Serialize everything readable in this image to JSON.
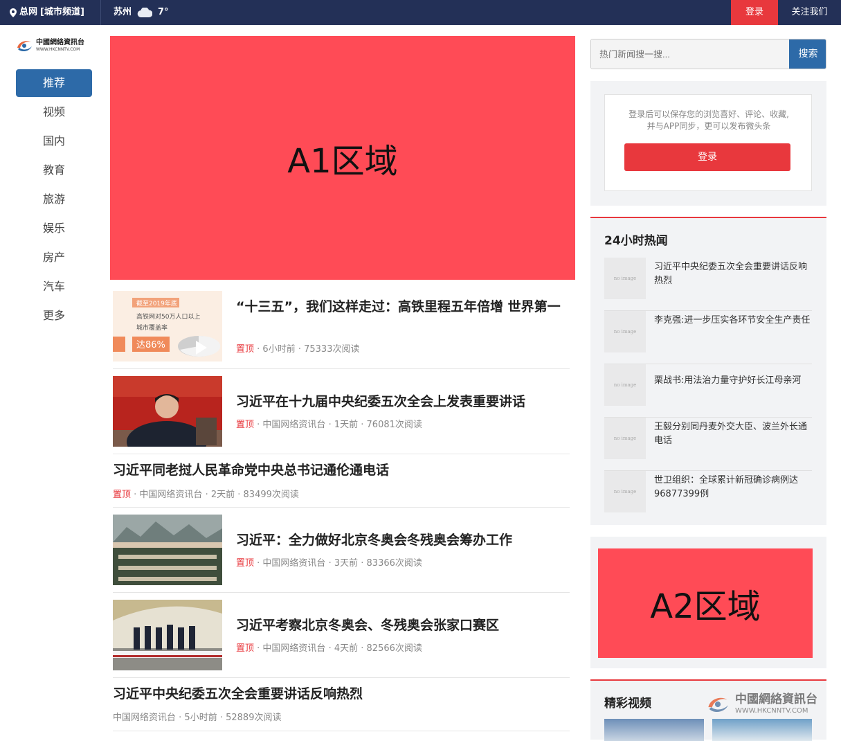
{
  "topbar": {
    "location": "总网",
    "channel": "[城市频道]",
    "city": "苏州",
    "temperature": "7°",
    "login": "登录",
    "follow": "关注我们"
  },
  "logo": {
    "name": "中國網絡資訊台",
    "url": "WWW.HKCNNTV.COM"
  },
  "nav": {
    "items": [
      "推荐",
      "视频",
      "国内",
      "教育",
      "旅游",
      "娱乐",
      "房产",
      "汽车",
      "更多"
    ]
  },
  "banner_a1": "A1区域",
  "banner_a2": "A2区域",
  "news": [
    {
      "title": "“十三五”，我们这样走过：高铁里程五年倍增 世界第一",
      "top": "置顶",
      "source": "",
      "time": "6小时前",
      "reads": "75333次阅读",
      "thumb_text": {
        "l1": "截至2019年底",
        "l2": "高铁网对50万人口以上",
        "l3": "城市覆盖率",
        "pct": "达86%"
      }
    },
    {
      "title": "习近平在十九届中央纪委五次全会上发表重要讲话",
      "top": "置顶",
      "source": "中国网络资讯台",
      "time": "1天前",
      "reads": "76081次阅读"
    },
    {
      "title": "习近平同老挝人民革命党中央总书记通伦通电话",
      "top": "置顶",
      "source": "中国网络资讯台",
      "time": "2天前",
      "reads": "83499次阅读"
    },
    {
      "title": "习近平：全力做好北京冬奥会冬残奥会筹办工作",
      "top": "置顶",
      "source": "中国网络资讯台",
      "time": "3天前",
      "reads": "83366次阅读"
    },
    {
      "title": "习近平考察北京冬奥会、冬残奥会张家口赛区",
      "top": "置顶",
      "source": "中国网络资讯台",
      "time": "4天前",
      "reads": "82566次阅读"
    },
    {
      "title": "习近平中央纪委五次全会重要讲话反响热烈",
      "top": "",
      "source": "中国网络资讯台",
      "time": "5小时前",
      "reads": "52889次阅读"
    }
  ],
  "search": {
    "placeholder": "热门新闻搜一搜...",
    "button": "搜索"
  },
  "login_panel": {
    "line1": "登录后可以保存您的浏览喜好、评论、收藏,",
    "line2": "并与APP同步，更可以发布微头条",
    "button": "登录"
  },
  "hot": {
    "heading": "24小时热闻",
    "no_image": "no image",
    "items": [
      "习近平中央纪委五次全会重要讲话反响热烈",
      "李克强:进一步压实各环节安全生产责任",
      "栗战书:用法治力量守护好长江母亲河",
      "王毅分别同丹麦外交大臣、波兰外长通电话",
      "世卫组织：全球累计新冠确诊病例达96877399例"
    ]
  },
  "video": {
    "heading": "精彩视频"
  },
  "watermark": {
    "name": "中國網絡資訊台",
    "url": "WWW.HKCNNTV.COM"
  },
  "colors": {
    "topbar": "#233057",
    "accent_red": "#e8383d",
    "nav_active": "#2d6aa8",
    "banner": "#ff4b56"
  }
}
